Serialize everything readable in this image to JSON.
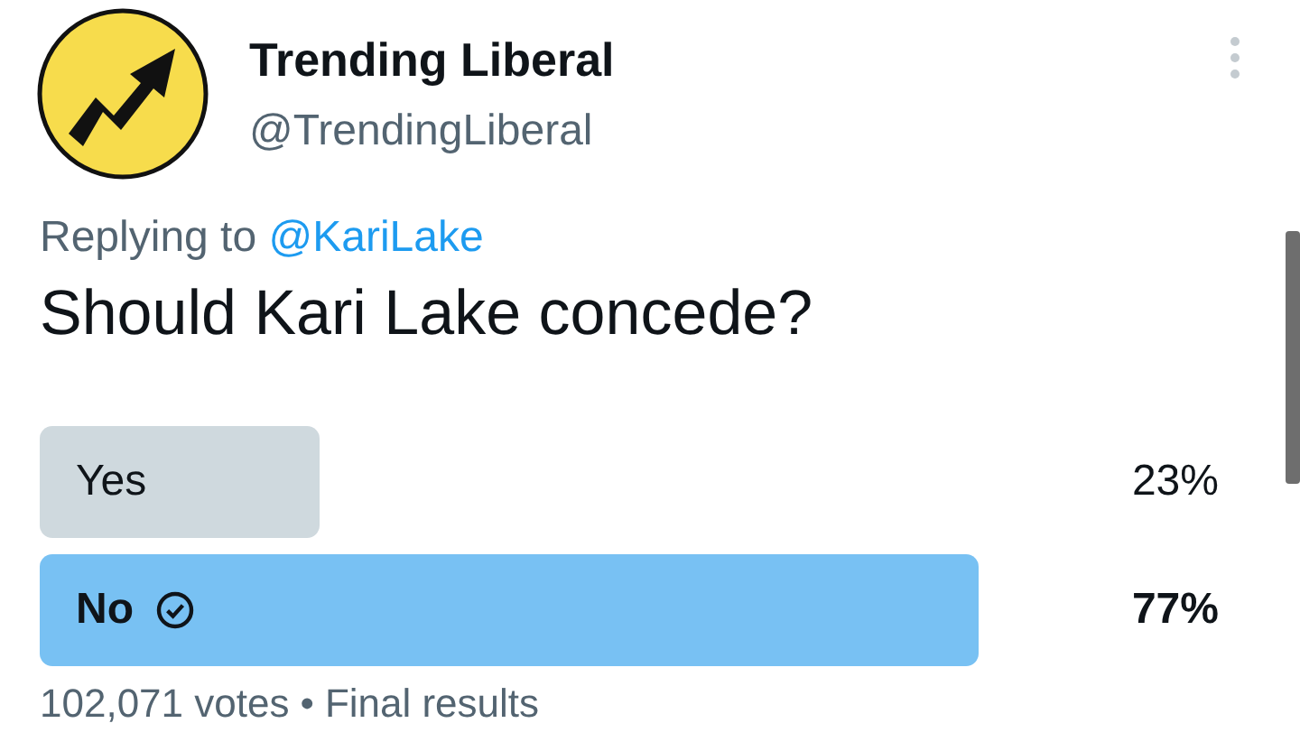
{
  "tweet": {
    "display_name": "Trending Liberal",
    "handle": "@TrendingLiberal",
    "replying_to": {
      "label": "Replying to",
      "mention": "@KariLake"
    },
    "text": "Should Kari Lake concede?"
  },
  "poll": {
    "options": [
      {
        "label": "Yes",
        "percent": "23%",
        "selected": false
      },
      {
        "label": "No",
        "percent": "77%",
        "selected": true
      }
    ],
    "votes": "102,071 votes",
    "separator": "•",
    "status": "Final results"
  }
}
